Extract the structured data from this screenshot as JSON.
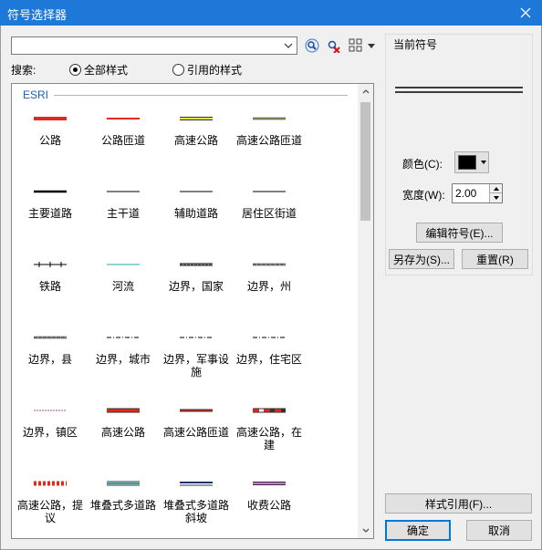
{
  "window": {
    "title": "符号选择器"
  },
  "search": {
    "value": "",
    "label": "搜索:",
    "options": [
      {
        "label": "全部样式",
        "selected": true
      },
      {
        "label": "引用的样式",
        "selected": false
      }
    ]
  },
  "gallery": {
    "group": "ESRI",
    "items": [
      {
        "label": "公路",
        "style": "red-thick"
      },
      {
        "label": "公路匝道",
        "style": "red-thin"
      },
      {
        "label": "高速公路",
        "style": "yellow-cased"
      },
      {
        "label": "高速公路匝道",
        "style": "olive-cased"
      },
      {
        "label": "主要道路",
        "style": "black-thick"
      },
      {
        "label": "主干道",
        "style": "black-thin"
      },
      {
        "label": "辅助道路",
        "style": "black-thin"
      },
      {
        "label": "居住区街道",
        "style": "black-thin"
      },
      {
        "label": "铁路",
        "style": "railroad"
      },
      {
        "label": "河流",
        "style": "teal-thin"
      },
      {
        "label": "边界，国家",
        "style": "gray-dash-thick"
      },
      {
        "label": "边界，州",
        "style": "gray-dash"
      },
      {
        "label": "边界，县",
        "style": "gray-dash"
      },
      {
        "label": "边界，城市",
        "style": "black-dashdot"
      },
      {
        "label": "边界，军事设施",
        "style": "black-dashdot"
      },
      {
        "label": "边界，住宅区",
        "style": "black-dashdot"
      },
      {
        "label": "边界，镇区",
        "style": "purple-dash"
      },
      {
        "label": "高速公路",
        "style": "red-cased"
      },
      {
        "label": "高速公路匝道",
        "style": "darkred-cased"
      },
      {
        "label": "高速公路，在建",
        "style": "red-white-dash"
      },
      {
        "label": "高速公路，提议",
        "style": "red-dotted"
      },
      {
        "label": "堆叠式多道路",
        "style": "teal-double"
      },
      {
        "label": "堆叠式多道路斜坡",
        "style": "navy-double"
      },
      {
        "label": "收费公路",
        "style": "purple-cased"
      }
    ]
  },
  "current": {
    "title": "当前符号",
    "color_label": "颜色(C):",
    "color_value": "#000000",
    "width_label": "宽度(W):",
    "width_value": "2.00",
    "edit_button": "编辑符号(E)...",
    "save_as_button": "另存为(S)...",
    "reset_button": "重置(R)"
  },
  "footer": {
    "style_ref_button": "样式引用(F)...",
    "ok_button": "确定",
    "cancel_button": "取消"
  }
}
